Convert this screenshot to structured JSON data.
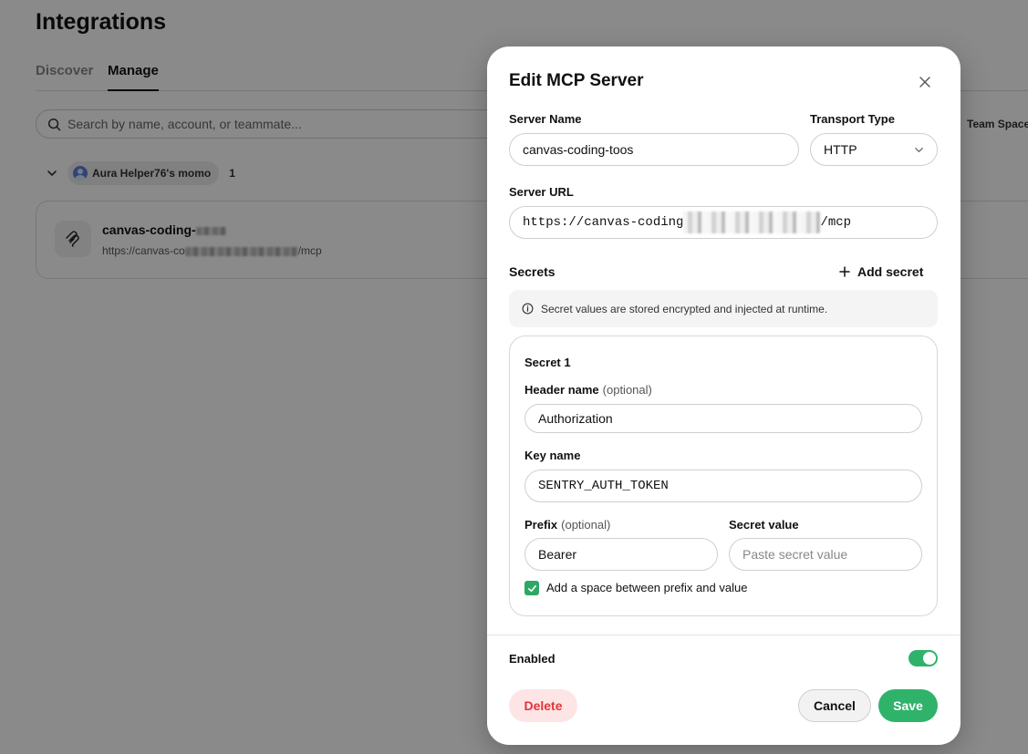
{
  "page": {
    "title": "Integrations",
    "tabs": [
      {
        "label": "Discover",
        "active": false
      },
      {
        "label": "Manage",
        "active": true
      }
    ],
    "search_placeholder": "Search by name, account, or teammate...",
    "team_space_label": "Team Space",
    "group": {
      "owner": "Aura Helper76's momo",
      "count": "1"
    },
    "server_card": {
      "name": "canvas-coding-",
      "url_prefix": "https://canvas-co",
      "url_suffix": "/mcp"
    }
  },
  "modal": {
    "title": "Edit MCP Server",
    "server_name_label": "Server Name",
    "server_name_value": "canvas-coding-toos",
    "transport_label": "Transport Type",
    "transport_value": "HTTP",
    "server_url_label": "Server URL",
    "server_url_prefix": "https://canvas-coding",
    "server_url_suffix": "/mcp",
    "secrets_label": "Secrets",
    "add_secret_label": "Add secret",
    "info_text": "Secret values are stored encrypted and injected at runtime.",
    "secret": {
      "title": "Secret 1",
      "header_name_label": "Header name",
      "optional_text": "(optional)",
      "header_name_value": "Authorization",
      "key_name_label": "Key name",
      "key_name_value": "SENTRY_AUTH_TOKEN",
      "prefix_label": "Prefix",
      "prefix_value": "Bearer",
      "secret_value_label": "Secret value",
      "secret_value_placeholder": "Paste secret value",
      "space_checkbox_label": "Add a space between prefix and value",
      "space_checkbox_checked": true
    },
    "enabled_label": "Enabled",
    "enabled": true,
    "delete_label": "Delete",
    "cancel_label": "Cancel",
    "save_label": "Save"
  },
  "colors": {
    "accent_green": "#2fb36a",
    "danger_red": "#e0353b",
    "danger_bg": "#fde5e5",
    "overlay": "rgba(0,0,0,0.46)"
  },
  "icons": [
    "search-icon",
    "chevron-down-icon",
    "user-avatar-icon",
    "mcp-logo-icon",
    "close-icon",
    "plus-icon",
    "info-icon",
    "check-icon"
  ]
}
